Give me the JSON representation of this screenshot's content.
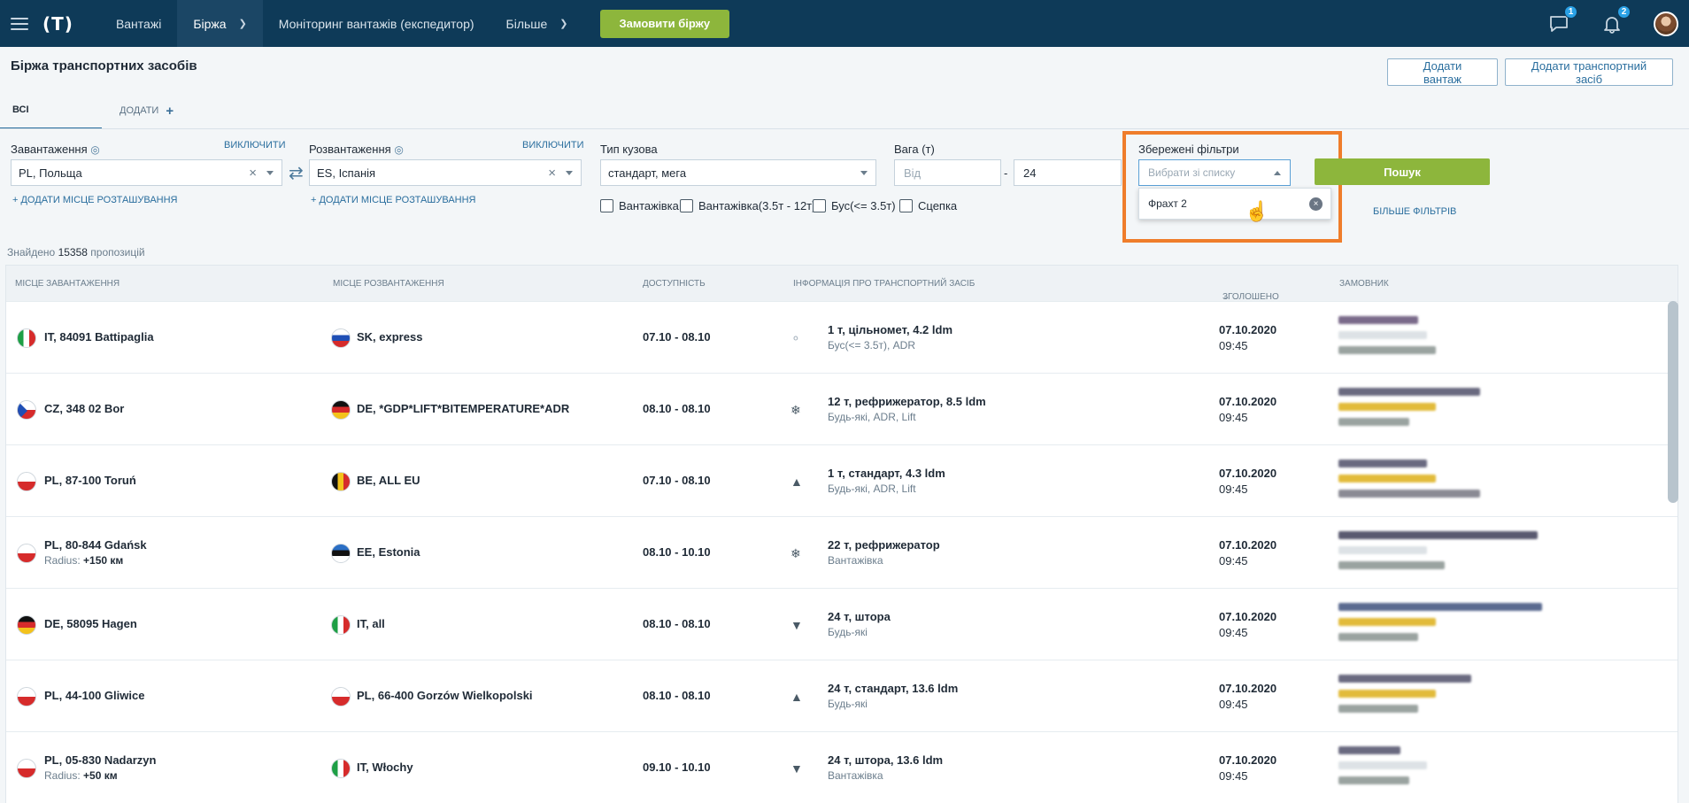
{
  "nav": {
    "logo": "(T)",
    "items": [
      {
        "label": "Вантажі"
      },
      {
        "label": "Біржа"
      },
      {
        "label": "Моніторинг вантажів (експедитор)"
      },
      {
        "label": "Більше"
      }
    ],
    "order_button": "Замовити біржу",
    "chat_badge": "1",
    "notif_badge": "2"
  },
  "header": {
    "title": "Біржа транспортних засобів",
    "add_cargo": "Додати вантаж",
    "add_vehicle": "Додати транспортний засіб"
  },
  "tabs": {
    "all": "всі",
    "add": "ДОДАТИ"
  },
  "filters": {
    "loading_label": "Завантаження",
    "loading_exclude": "ВИКЛЮЧИТИ",
    "loading_value": "PL,  Польща",
    "loading_add": "+ ДОДАТИ МІСЦЕ РОЗТАШУВАННЯ",
    "unloading_label": "Розвантаження",
    "unloading_exclude": "ВИКЛЮЧИТИ",
    "unloading_value": "ES,  Іспанія",
    "unloading_add": "+ ДОДАТИ МІСЦЕ РОЗТАШУВАННЯ",
    "body_label": "Тип кузова",
    "body_value": "стандарт, мега",
    "checkboxes": [
      "Вантажівка",
      "Вантажівка(3.5т - 12т)",
      "Бус(<= 3.5т)",
      "Сцепка"
    ],
    "weight_label": "Вага (т)",
    "weight_from_placeholder": "Від",
    "weight_to": "24",
    "saved_label": "Збережені фільтри",
    "saved_placeholder": "Вибрати зі списку",
    "saved_option": "Фрахт 2",
    "search": "Пошук",
    "more": "БІЛЬШЕ ФІЛЬТРІВ"
  },
  "results": {
    "found_prefix": "Знайдено",
    "found_count": "15358",
    "found_suffix": "пропозицій",
    "columns": [
      "МІСЦЕ ЗАВАНТАЖЕННЯ",
      "МІСЦЕ РОЗВАНТАЖЕННЯ",
      "ДОСТУПНІСТЬ",
      "ІНФОРМАЦІЯ ПРО ТРАНСПОРТНИЙ ЗАСІБ",
      "ЗГОЛОШЕНО",
      "ЗАМОВНИК"
    ],
    "rows": [
      {
        "from": "IT, 84091 Battipaglia",
        "to": "SK, express",
        "avail": "07.10 - 08.10",
        "vehicle": "1 т, цільномет, 4.2 ldm",
        "vehicle_sub": "Бус(<= 3.5т), ADR",
        "date": "07.10.2020",
        "time": "09:45"
      },
      {
        "from": "CZ, 348 02 Bor",
        "to": "DE, *GDP*LIFT*BITEMPERATURE*ADR",
        "avail": "08.10 - 08.10",
        "vehicle": "12 т, рефрижератор, 8.5 ldm",
        "vehicle_sub": "Будь-які, ADR, Lift",
        "date": "07.10.2020",
        "time": "09:45"
      },
      {
        "from": "PL, 87-100 Toruń",
        "to": "BE, ALL EU",
        "avail": "07.10 - 08.10",
        "vehicle": "1 т, стандарт, 4.3 ldm",
        "vehicle_sub": "Будь-які, ADR, Lift",
        "date": "07.10.2020",
        "time": "09:45"
      },
      {
        "from": "PL, 80-844 Gdańsk",
        "from_sub_label": "Radius:",
        "from_sub_value": "+150 км",
        "to": "EE, Estonia",
        "avail": "08.10 - 10.10",
        "vehicle": "22 т, рефрижератор",
        "vehicle_sub": "Вантажівка",
        "date": "07.10.2020",
        "time": "09:45"
      },
      {
        "from": "DE, 58095 Hagen",
        "to": "IT, all",
        "avail": "08.10 - 08.10",
        "vehicle": "24 т, штора",
        "vehicle_sub": "Будь-які",
        "date": "07.10.2020",
        "time": "09:45"
      },
      {
        "from": "PL, 44-100 Gliwice",
        "to": "PL, 66-400 Gorzów Wielkopolski",
        "avail": "08.10 - 08.10",
        "vehicle": "24 т, стандарт, 13.6 ldm",
        "vehicle_sub": "Будь-які",
        "date": "07.10.2020",
        "time": "09:45"
      },
      {
        "from": "PL, 05-830 Nadarzyn",
        "from_sub_label": "Radius:",
        "from_sub_value": "+50 км",
        "to": "IT, Włochy",
        "avail": "09.10 - 10.10",
        "vehicle": "24 т, штора, 13.6 ldm",
        "vehicle_sub": "Вантажівка",
        "date": "07.10.2020",
        "time": "09:45"
      }
    ]
  },
  "colors": {
    "nav_bg": "#0e3a58",
    "accent_green": "#8db63c",
    "highlight": "#ef7d2b",
    "link": "#2a6e9e"
  }
}
